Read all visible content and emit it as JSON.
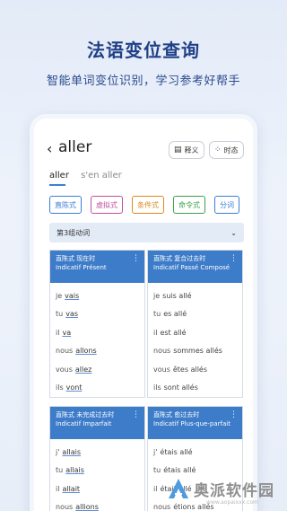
{
  "promo": {
    "headline": "法语变位查询",
    "subline": "智能单词变位识别，学习参考好帮手"
  },
  "app": {
    "back_icon": "chevron-left-icon",
    "verb": "aller",
    "definition_label": "释义",
    "tense_label": "时态",
    "verb_tabs": [
      "aller",
      "s'en aller"
    ],
    "moods": [
      {
        "label": "直陈式",
        "color": "#3a7fd5"
      },
      {
        "label": "虚拟式",
        "color": "#c64fa1"
      },
      {
        "label": "条件式",
        "color": "#e08a1e"
      },
      {
        "label": "命令式",
        "color": "#3aa24a"
      },
      {
        "label": "分词",
        "color": "#3a7fd5"
      }
    ],
    "group": "第3组动词",
    "cards_top": [
      {
        "title_zh": "直陈式 现在时",
        "title_fr": "Indicatif Présent",
        "rows": [
          {
            "pron": "je",
            "form": "vais"
          },
          {
            "pron": "tu",
            "form": "vas"
          },
          {
            "pron": "il",
            "form": "va"
          },
          {
            "pron": "nous",
            "form": "allons"
          },
          {
            "pron": "vous",
            "form": "allez"
          },
          {
            "pron": "ils",
            "form": "vont"
          }
        ]
      },
      {
        "title_zh": "直陈式 复合过去时",
        "title_fr": "Indicatif Passé Composé",
        "rows": [
          {
            "pron": "je",
            "form": "suis allé"
          },
          {
            "pron": "tu",
            "form": "es allé"
          },
          {
            "pron": "il",
            "form": "est allé"
          },
          {
            "pron": "nous",
            "form": "sommes allés"
          },
          {
            "pron": "vous",
            "form": "êtes allés"
          },
          {
            "pron": "ils",
            "form": "sont allés"
          }
        ]
      }
    ],
    "cards_bottom": [
      {
        "title_zh": "直陈式 未完成过去时",
        "title_fr": "Indicatif Imparfait",
        "rows": [
          {
            "pron": "j'",
            "form": "allais"
          },
          {
            "pron": "tu",
            "form": "allais"
          },
          {
            "pron": "il",
            "form": "allait"
          },
          {
            "pron": "nous",
            "form": "allions"
          }
        ]
      },
      {
        "title_zh": "直陈式 愈过去时",
        "title_fr": "Indicatif Plus-que-parfait",
        "rows": [
          {
            "pron": "j'",
            "form": "étais allé"
          },
          {
            "pron": "tu",
            "form": "étais allé"
          },
          {
            "pron": "il",
            "form": "était allé"
          },
          {
            "pron": "nous",
            "form": "étions allés"
          }
        ]
      }
    ]
  },
  "watermark": {
    "text": "奥派软件园",
    "url": "www.aopaixxx.com"
  }
}
